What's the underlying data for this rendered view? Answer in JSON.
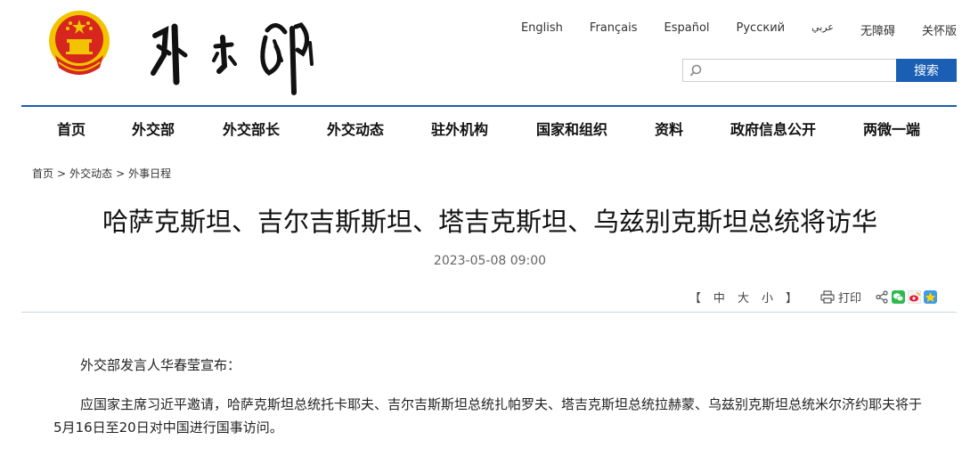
{
  "header": {
    "site_name": "外交部",
    "emblem": "national-emblem",
    "languages": [
      "English",
      "Français",
      "Español",
      "Русский",
      "عربي",
      "无障碍",
      "关怀版"
    ]
  },
  "search": {
    "placeholder": "",
    "button_label": "搜索"
  },
  "nav": {
    "items": [
      "首页",
      "外交部",
      "外交部长",
      "外交动态",
      "驻外机构",
      "国家和组织",
      "资料",
      "政府信息公开",
      "两微一端"
    ]
  },
  "breadcrumb": {
    "items": [
      "首页",
      "外交动态",
      "外事日程"
    ],
    "separator": ">"
  },
  "article": {
    "title": "哈萨克斯坦、吉尔吉斯斯坦、塔吉克斯坦、乌兹别克斯坦总统将访华",
    "date": "2023-05-08 09:00",
    "paragraphs": [
      "外交部发言人华春莹宣布：",
      "应国家主席习近平邀请，哈萨克斯坦总统托卡耶夫、吉尔吉斯斯坦总统扎帕罗夫、塔吉克斯坦总统拉赫蒙、乌兹别克斯坦总统米尔济约耶夫将于5月16日至20日对中国进行国事访问。"
    ]
  },
  "tools": {
    "bracket_left": "【",
    "size_large": "中",
    "size_medium": "大",
    "size_small": "小",
    "bracket_right": "】",
    "print_label": "打印",
    "share_icons": [
      "share-icon",
      "wechat-icon",
      "weibo-icon",
      "qzone-icon"
    ]
  },
  "colors": {
    "accent": "#1a5fb4",
    "emblem_red": "#d7261e",
    "emblem_gold": "#f2c400"
  }
}
